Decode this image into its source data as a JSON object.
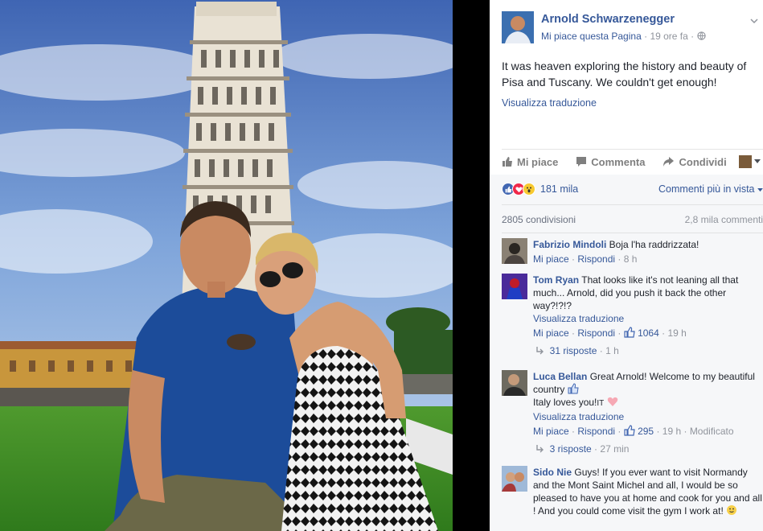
{
  "post": {
    "page_name": "Arnold Schwarzenegger",
    "like_page": "Mi piace questa Pagina",
    "time": "19 ore fa",
    "dot": "·",
    "text": "It was heaven exploring the history and beauty of Pisa and Tuscany. We couldn't get enough!",
    "translate": "Visualizza traduzione"
  },
  "actions": {
    "like": "Mi piace",
    "comment": "Commenta",
    "share": "Condividi"
  },
  "stats": {
    "reactions": "181 mila",
    "sort": "Commenti più in vista",
    "shares": "2805 condivisioni",
    "comments": "2,8 mila commenti"
  },
  "comments": [
    {
      "name": "Fabrizio Mindoli",
      "text": "Boja l'ha raddrizzata!",
      "like": "Mi piace",
      "reply": "Rispondi",
      "time": "8 h"
    },
    {
      "name": "Tom Ryan",
      "text": "That looks like it's not leaning all that much... Arnold, did you push it back the other way?!?!?",
      "translate": "Visualizza traduzione",
      "like": "Mi piace",
      "reply": "Rispondi",
      "likes": "1064",
      "time": "19 h",
      "replies": "31 risposte",
      "replies_time": "1 h"
    },
    {
      "name": "Luca Bellan",
      "text_a": "Great Arnold! Welcome to my beautiful country",
      "text_b": "Italy loves you!",
      "text_c": "IT",
      "translate": "Visualizza traduzione",
      "like": "Mi piace",
      "reply": "Rispondi",
      "likes": "295",
      "time": "19 h",
      "edited": "Modificato",
      "replies": "3 risposte",
      "replies_time": "27 min"
    },
    {
      "name": "Sido Nie",
      "text": "Guys! If you ever want to visit Normandy and the Mont Saint Michel and all, I would be so pleased to have you at home and cook for you and all ! And you could come visit the gym I work at!"
    }
  ],
  "colors": {
    "link": "#365899",
    "muted": "#90949c",
    "text": "#1d2129",
    "panel_bg": "#f6f7f9"
  }
}
